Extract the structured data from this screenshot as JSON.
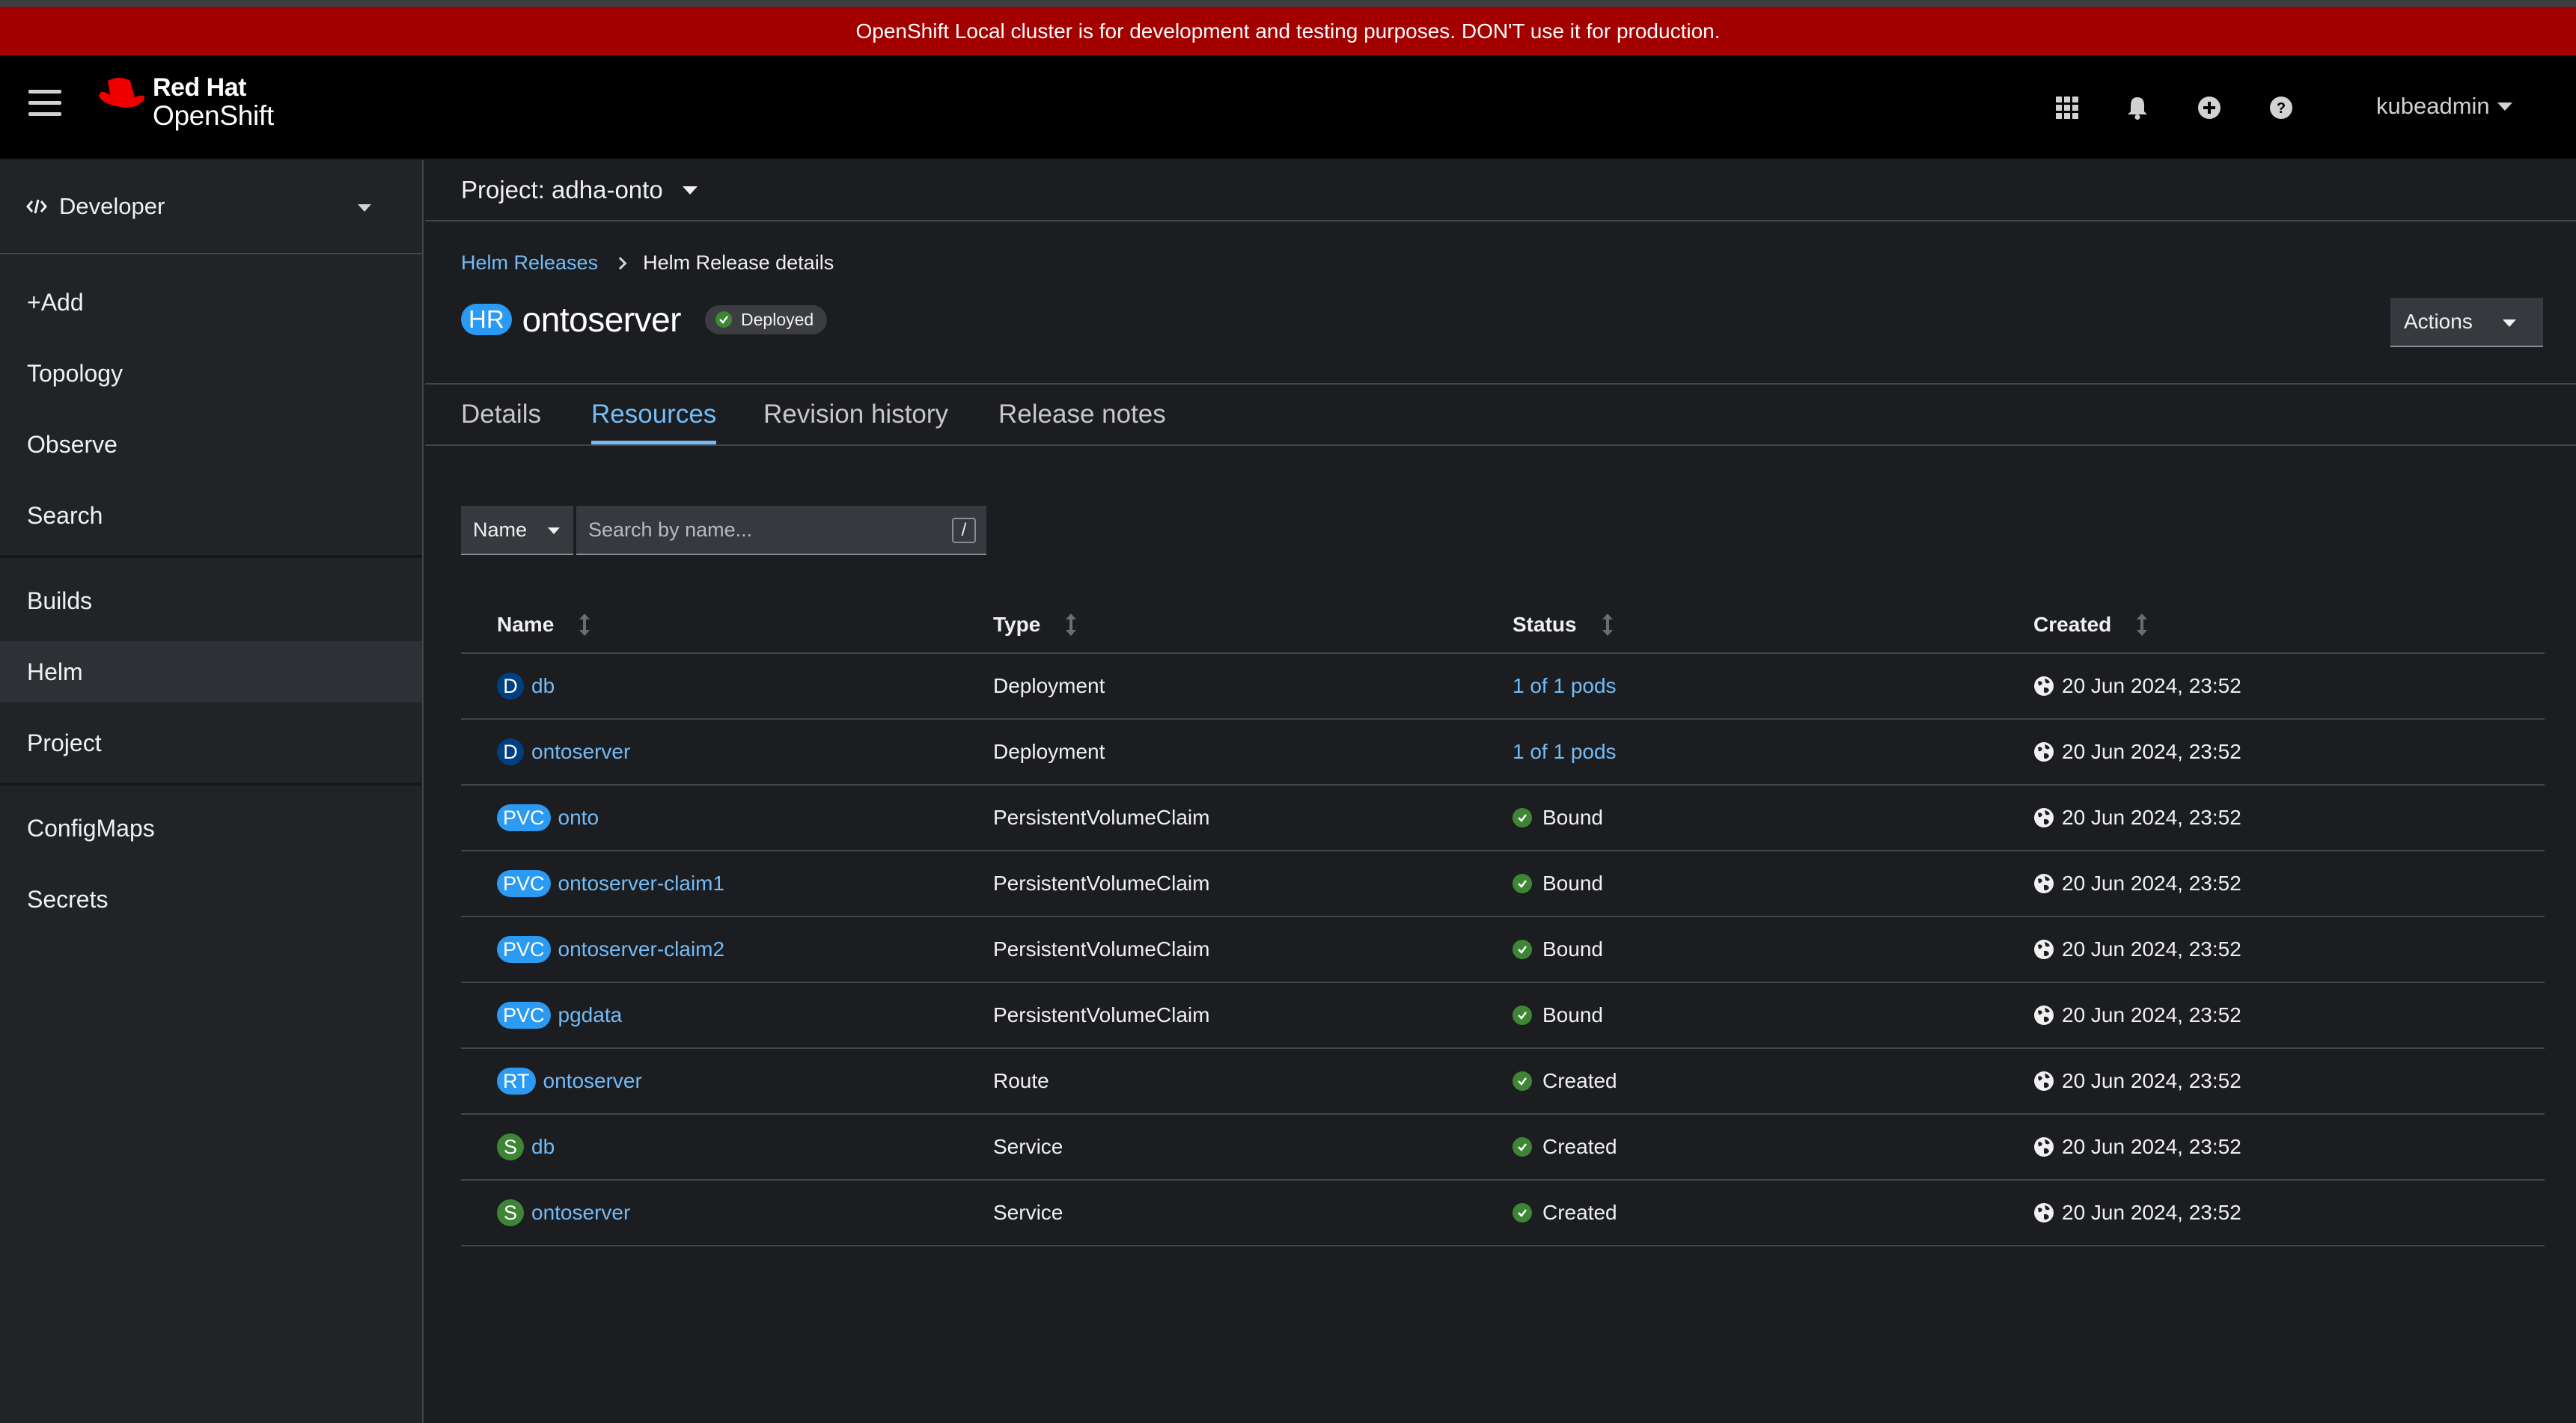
{
  "banner": "OpenShift Local cluster is for development and testing purposes. DON'T use it for production.",
  "brand": {
    "line1": "Red Hat",
    "line2": "OpenShift"
  },
  "masthead": {
    "user": "kubeadmin"
  },
  "sidebar": {
    "perspective": "Developer",
    "items": [
      {
        "label": "+Add"
      },
      {
        "label": "Topology"
      },
      {
        "label": "Observe"
      },
      {
        "label": "Search"
      },
      {
        "label": "Builds"
      },
      {
        "label": "Helm",
        "active": true
      },
      {
        "label": "Project"
      },
      {
        "label": "ConfigMaps"
      },
      {
        "label": "Secrets"
      }
    ]
  },
  "project": {
    "label": "Project: adha-onto"
  },
  "breadcrumb": {
    "parent": "Helm Releases",
    "current": "Helm Release details"
  },
  "release": {
    "badge": "HR",
    "name": "ontoserver",
    "status": "Deployed"
  },
  "actions_label": "Actions",
  "tabs": [
    "Details",
    "Resources",
    "Revision history",
    "Release notes"
  ],
  "active_tab": "Resources",
  "filter": {
    "select": "Name",
    "placeholder": "Search by name...",
    "hint": "/"
  },
  "table": {
    "headers": [
      "Name",
      "Type",
      "Status",
      "Created"
    ],
    "rows": [
      {
        "badge": "D",
        "name": "db",
        "type": "Deployment",
        "status": "1 of 1 pods",
        "status_kind": "link",
        "created": "20 Jun 2024, 23:52"
      },
      {
        "badge": "D",
        "name": "ontoserver",
        "type": "Deployment",
        "status": "1 of 1 pods",
        "status_kind": "link",
        "created": "20 Jun 2024, 23:52"
      },
      {
        "badge": "PVC",
        "name": "onto",
        "type": "PersistentVolumeClaim",
        "status": "Bound",
        "status_kind": "ok",
        "created": "20 Jun 2024, 23:52"
      },
      {
        "badge": "PVC",
        "name": "ontoserver-claim1",
        "type": "PersistentVolumeClaim",
        "status": "Bound",
        "status_kind": "ok",
        "created": "20 Jun 2024, 23:52"
      },
      {
        "badge": "PVC",
        "name": "ontoserver-claim2",
        "type": "PersistentVolumeClaim",
        "status": "Bound",
        "status_kind": "ok",
        "created": "20 Jun 2024, 23:52"
      },
      {
        "badge": "PVC",
        "name": "pgdata",
        "type": "PersistentVolumeClaim",
        "status": "Bound",
        "status_kind": "ok",
        "created": "20 Jun 2024, 23:52"
      },
      {
        "badge": "RT",
        "name": "ontoserver",
        "type": "Route",
        "status": "Created",
        "status_kind": "ok",
        "created": "20 Jun 2024, 23:52"
      },
      {
        "badge": "S",
        "name": "db",
        "type": "Service",
        "status": "Created",
        "status_kind": "ok",
        "created": "20 Jun 2024, 23:52"
      },
      {
        "badge": "S",
        "name": "ontoserver",
        "type": "Service",
        "status": "Created",
        "status_kind": "ok",
        "created": "20 Jun 2024, 23:52"
      }
    ]
  },
  "colors": {
    "banner": "#a30000",
    "link": "#73bcf7",
    "success": "#3e8635",
    "accent": "#2b9af3"
  }
}
